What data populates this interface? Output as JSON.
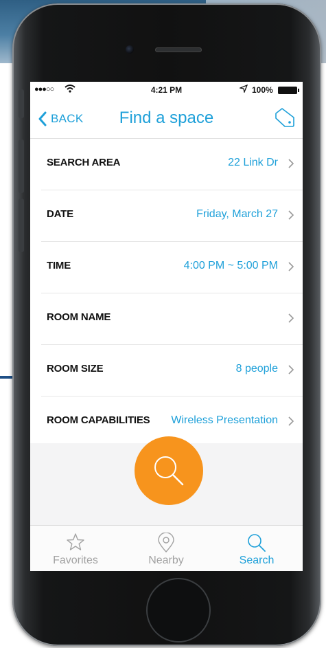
{
  "status_bar": {
    "signal": "●●●○○",
    "time": "4:21 PM",
    "battery": "100%"
  },
  "nav": {
    "back_label": "BACK",
    "title": "Find a space"
  },
  "rows": [
    {
      "label": "SEARCH AREA",
      "value": "22 Link Dr"
    },
    {
      "label": "DATE",
      "value": "Friday, March 27"
    },
    {
      "label": "TIME",
      "value": "4:00 PM ~ 5:00 PM"
    },
    {
      "label": "ROOM NAME",
      "value": ""
    },
    {
      "label": "ROOM SIZE",
      "value": "8 people"
    },
    {
      "label": "ROOM CAPABILITIES",
      "value": "Wireless Presentation"
    }
  ],
  "tabs": [
    {
      "label": "Favorites",
      "icon": "star-icon",
      "active": false
    },
    {
      "label": "Nearby",
      "icon": "location-pin-icon",
      "active": false
    },
    {
      "label": "Search",
      "icon": "search-icon",
      "active": true
    }
  ],
  "colors": {
    "accent": "#1ea0d9",
    "fab": "#f7941d",
    "inactive_tab": "#a2a2a2"
  }
}
